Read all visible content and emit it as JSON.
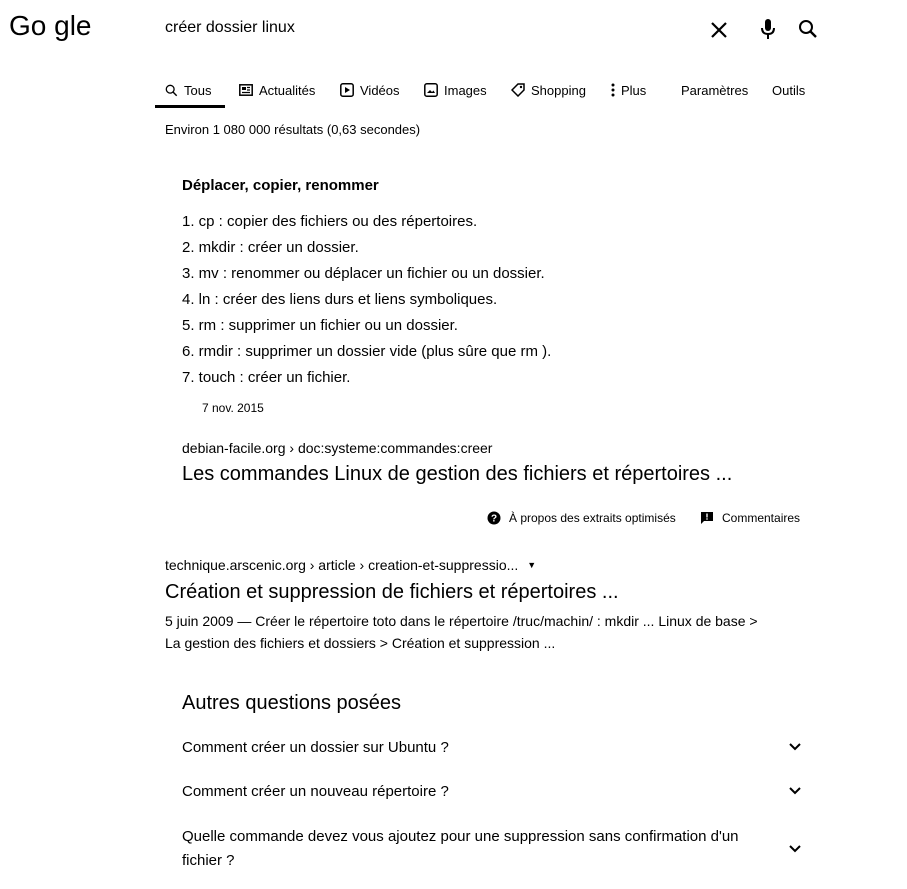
{
  "logo": {
    "text": "Go gle"
  },
  "search": {
    "query": "créer dossier linux"
  },
  "icons": {
    "clear": "close-icon",
    "voice": "mic-icon",
    "search": "search-icon"
  },
  "tabs": [
    {
      "label": "Tous",
      "icon": "search-icon",
      "active": true
    },
    {
      "label": "Actualités",
      "icon": "news-icon"
    },
    {
      "label": "Vidéos",
      "icon": "video-icon"
    },
    {
      "label": "Images",
      "icon": "image-icon"
    },
    {
      "label": "Shopping",
      "icon": "tag-icon"
    },
    {
      "label": "Plus",
      "icon": "more-vert-icon"
    },
    {
      "label": "Paramètres"
    },
    {
      "label": "Outils"
    }
  ],
  "stats": "Environ 1 080 000 résultats (0,63 secondes)",
  "featured": {
    "heading": "Déplacer, copier, renommer",
    "items": [
      "1. cp : copier des fichiers ou des répertoires.",
      "2. mkdir : créer un dossier.",
      "3. mv : renommer ou déplacer un fichier ou un dossier.",
      "4. ln : créer des liens durs et liens symboliques.",
      "5. rm : supprimer un fichier ou un dossier.",
      "6. rmdir : supprimer un dossier vide (plus sûre que rm ).",
      "7. touch : créer un fichier."
    ],
    "date": "7 nov. 2015",
    "url": "debian-facile.org › doc:systeme:commandes:creer",
    "title": "Les commandes Linux de gestion des fichiers et répertoires ...",
    "about_label": "À propos des extraits optimisés",
    "feedback_label": "Commentaires"
  },
  "result2": {
    "url": "technique.arscenic.org › article › creation-et-suppressio...",
    "title": "Création et suppression de fichiers et répertoires ...",
    "description": "5 juin 2009 — Créer le répertoire toto dans le répertoire /truc/machin/ : mkdir ... Linux de base > La gestion des fichiers et dossiers > Création et suppression ..."
  },
  "paa": {
    "title": "Autres questions posées",
    "questions": [
      "Comment créer un dossier sur Ubuntu ?",
      "Comment créer un nouveau répertoire ?",
      "Quelle commande devez vous ajoutez pour une suppression sans confirmation d'un fichier ?"
    ]
  }
}
